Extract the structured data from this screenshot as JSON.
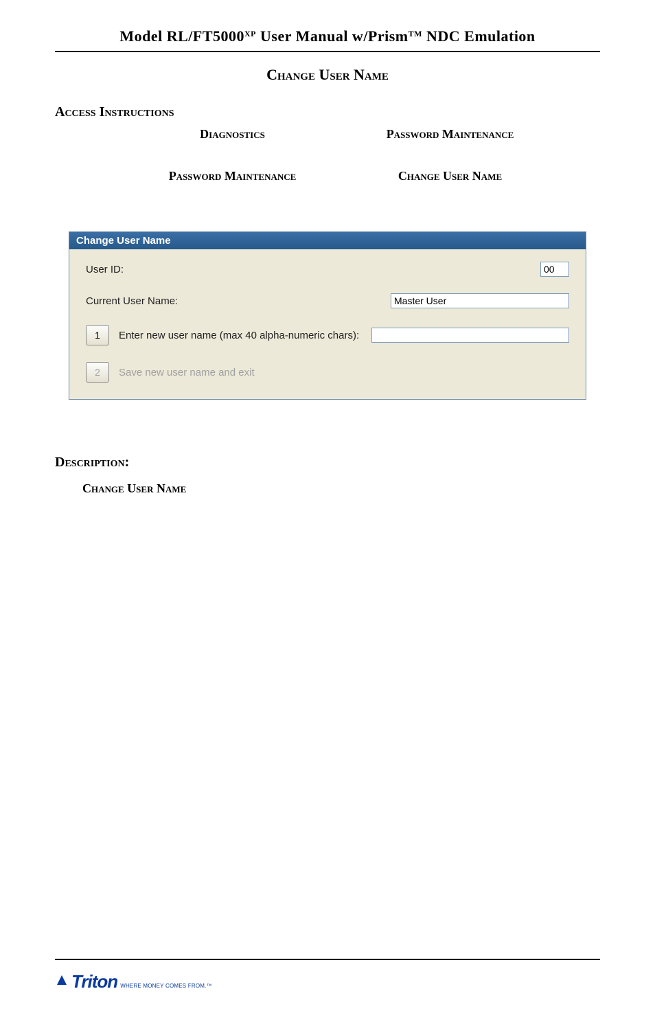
{
  "header": {
    "title_pre": "Model RL/FT5000",
    "title_sup1": "XP",
    "title_mid": " User Manual w/Prism",
    "title_sup2": "TM",
    "title_post": " NDC Emulation"
  },
  "page": {
    "heading": "Change User Name",
    "access_label": "Access Instructions",
    "instructions": {
      "tl": "Diagnostics",
      "tr": "Password Maintenance",
      "bl": "Password Maintenance",
      "br": "Change User Name"
    }
  },
  "window": {
    "title": "Change User Name",
    "user_id_label": "User ID:",
    "user_id_value": "00",
    "current_user_name_label": "Current User Name:",
    "current_user_name_value": "Master User",
    "row1_btn": "1",
    "row1_label": "Enter new user name (max 40 alpha-numeric chars):",
    "row1_value": "",
    "row2_btn": "2",
    "row2_label": "Save new user name and exit"
  },
  "description": {
    "label": "Description:",
    "emph": "Change User Name"
  },
  "footer": {
    "brand": "Triton",
    "tagline": "WHERE MONEY COMES FROM.™"
  }
}
